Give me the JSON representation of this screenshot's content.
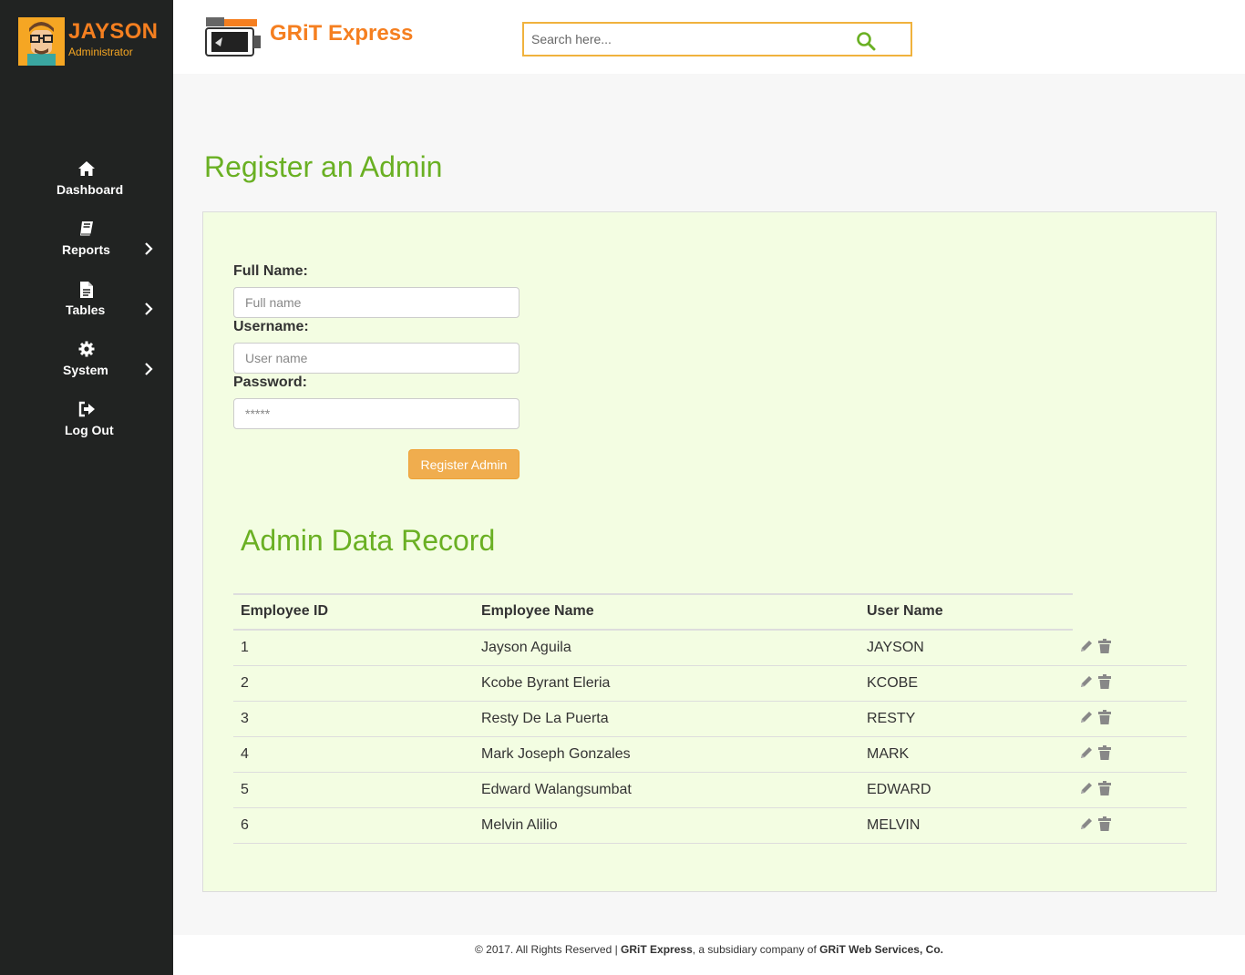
{
  "profile": {
    "name": "JAYSON",
    "role": "Administrator"
  },
  "nav": [
    {
      "label": "Dashboard",
      "icon": "home-icon",
      "has_submenu": false
    },
    {
      "label": "Reports",
      "icon": "book-icon",
      "has_submenu": true
    },
    {
      "label": "Tables",
      "icon": "file-icon",
      "has_submenu": true
    },
    {
      "label": "System",
      "icon": "gear-icon",
      "has_submenu": true
    },
    {
      "label": "Log Out",
      "icon": "logout-icon",
      "has_submenu": false
    }
  ],
  "header": {
    "brand": "GRiT Express",
    "search_placeholder": "Search here..."
  },
  "page_title": "Register an Admin",
  "form": {
    "full_name_label": "Full Name:",
    "full_name_placeholder": "Full name",
    "username_label": "Username:",
    "username_placeholder": "User name",
    "password_label": "Password:",
    "password_placeholder": "*****",
    "submit_label": "Register Admin"
  },
  "records": {
    "title": "Admin Data Record",
    "columns": [
      "Employee ID",
      "Employee Name",
      "User Name"
    ],
    "rows": [
      {
        "id": "1",
        "name": "Jayson Aguila",
        "username": "JAYSON"
      },
      {
        "id": "2",
        "name": "Kcobe Byrant Eleria",
        "username": "KCOBE"
      },
      {
        "id": "3",
        "name": "Resty De La Puerta",
        "username": "RESTY"
      },
      {
        "id": "4",
        "name": "Mark Joseph Gonzales",
        "username": "MARK"
      },
      {
        "id": "5",
        "name": "Edward Walangsumbat",
        "username": "EDWARD"
      },
      {
        "id": "6",
        "name": "Melvin Alilio",
        "username": "MELVIN"
      }
    ]
  },
  "footer": {
    "prefix": "© 2017. All Rights Reserved | ",
    "brand": "GRiT Express",
    "middle": ", a subsidiary company of ",
    "company": "GRiT Web Services, Co."
  },
  "colors": {
    "accent_green": "#6ab023",
    "accent_orange": "#f57f20",
    "sidebar": "#212322",
    "panel": "#f3fde2"
  }
}
